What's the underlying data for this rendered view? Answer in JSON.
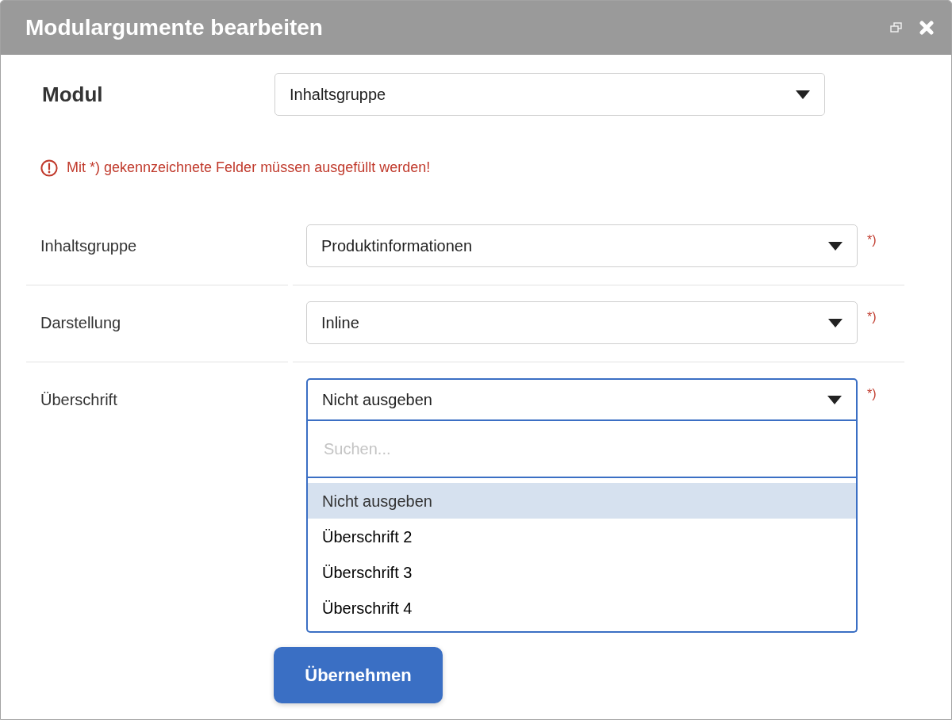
{
  "window": {
    "title": "Modulargumente bearbeiten"
  },
  "module": {
    "label": "Modul",
    "value": "Inhaltsgruppe"
  },
  "error": {
    "message": "Mit *) gekennzeichnete Felder müssen ausgefüllt werden!"
  },
  "fields": [
    {
      "label": "Inhaltsgruppe",
      "value": "Produktinformationen",
      "required_mark": "*)",
      "expanded": false
    },
    {
      "label": "Darstellung",
      "value": "Inline",
      "required_mark": "*)",
      "expanded": false
    },
    {
      "label": "Überschrift",
      "value": "Nicht ausgeben",
      "required_mark": "*)",
      "expanded": true,
      "dropdown": {
        "search": {
          "placeholder": "Suchen..."
        },
        "options": [
          {
            "label": "Nicht ausgeben",
            "selected": true
          },
          {
            "label": "Überschrift 2",
            "selected": false
          },
          {
            "label": "Überschrift 3",
            "selected": false
          },
          {
            "label": "Überschrift 4",
            "selected": false
          }
        ]
      }
    }
  ],
  "apply_button": {
    "label": "Übernehmen"
  }
}
